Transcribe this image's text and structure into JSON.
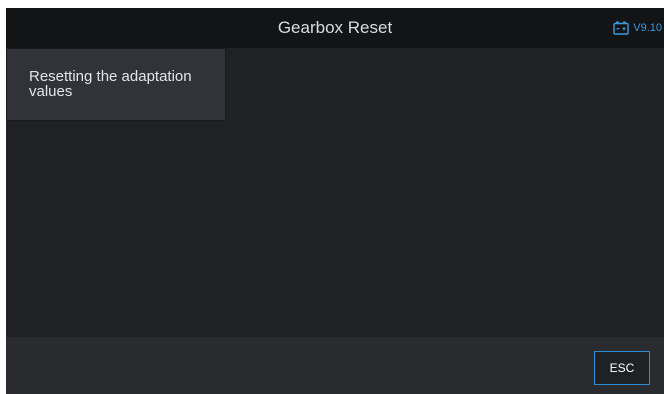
{
  "header": {
    "title": "Gearbox Reset",
    "version": "V9.10",
    "battery_icon": "battery-icon",
    "accent_color": "#3a9bdc"
  },
  "menu": {
    "items": [
      {
        "label": "Resetting the adaptation values"
      }
    ]
  },
  "footer": {
    "esc_label": "ESC"
  }
}
